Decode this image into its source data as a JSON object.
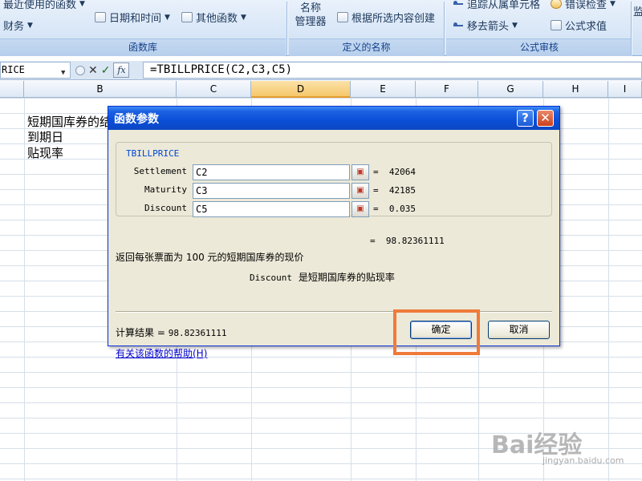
{
  "ribbon": {
    "recent_functions": "最近使用的函数",
    "finance": "财务",
    "datetime": "日期和时间",
    "other_functions": "其他函数",
    "group_function_library": "函数库",
    "name_manager": "名称\n管理器",
    "create_from_selection": "根据所选内容创建",
    "group_defined_names": "定义的名称",
    "trace_dependents": "追踪从属单元格",
    "remove_arrows": "移去箭头",
    "error_checking": "错误检查",
    "evaluate_formula": "公式求值",
    "group_formula_auditing": "公式审核",
    "watch_window_partial": "监"
  },
  "formula_bar": {
    "name_box": "RICE",
    "cancel_symbol": "✕",
    "enter_symbol": "✓",
    "fx_label": "fx",
    "formula": "=TBILLPRICE(C2,C3,C5)"
  },
  "columns": [
    "B",
    "C",
    "D",
    "E",
    "F",
    "G",
    "H",
    "I"
  ],
  "selected_column": "D",
  "cells": {
    "b2": "短期国库券的结",
    "b3": "到期日",
    "b4": "贴现率"
  },
  "dialog": {
    "title": "函数参数",
    "help_button": "?",
    "close_button": "✕",
    "function_name": "TBILLPRICE",
    "args": [
      {
        "label": "Settlement",
        "value": "C2",
        "result": "42064"
      },
      {
        "label": "Maturity",
        "value": "C3",
        "result": "42185"
      },
      {
        "label": "Discount",
        "value": "C5",
        "result": "0.035"
      }
    ],
    "ref_button_symbol": "▣",
    "equals": "=",
    "function_result": "98.82361111",
    "description": "返回每张票面为 100 元的短期国库券的现价",
    "arg_desc_name": "Discount",
    "arg_desc_text": "是短期国库券的贴现率",
    "calc_label": "计算结果 =",
    "calc_value": "98.82361111",
    "help_link": "有关该函数的帮助(H)",
    "ok_label": "确定",
    "cancel_label": "取消"
  },
  "watermark": {
    "brand": "Bai经验",
    "site": "jingyan.baidu.com"
  },
  "colors": {
    "title_bar": "#0a4ed8",
    "dialog_bg": "#ece9d8",
    "highlight": "#f07a3a",
    "selected_column": "#f6c76b"
  }
}
